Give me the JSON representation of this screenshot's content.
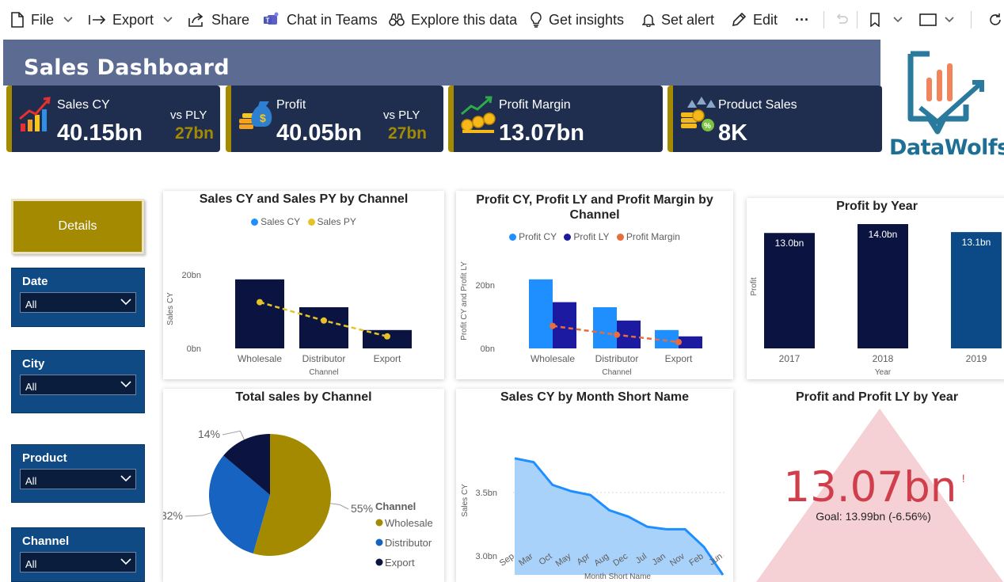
{
  "toolbar": {
    "file": "File",
    "export": "Export",
    "share": "Share",
    "chat_in_teams": "Chat in Teams",
    "explore": "Explore this data",
    "insights": "Get insights",
    "alert": "Set alert",
    "edit": "Edit",
    "more": "···"
  },
  "dashboard": {
    "title": "Sales Dashboard",
    "logo_text": "DataWolfs",
    "details_button": "Details"
  },
  "kpis": [
    {
      "label": "Sales CY",
      "value": "40.15bn",
      "vs": "vs PLY",
      "py": "27bn",
      "icon": "growth-chart-icon"
    },
    {
      "label": "Profit",
      "value": "40.05bn",
      "vs": "vs PLY",
      "py": "27bn",
      "icon": "money-bag-icon"
    },
    {
      "label": "Profit Margin",
      "value": "13.07bn",
      "icon": "coins-growth-icon"
    },
    {
      "label": "Product Sales",
      "value": "8K",
      "icon": "coins-percent-icon"
    }
  ],
  "slicers": [
    {
      "title": "Date",
      "value": "All"
    },
    {
      "title": "City",
      "value": "All"
    },
    {
      "title": "Product",
      "value": "All"
    },
    {
      "title": "Channel",
      "value": "All"
    }
  ],
  "colors": {
    "gold": "#a38a00",
    "navy": "#0b1441",
    "blue": "#1f8fff",
    "royal": "#1b1aa0",
    "orange": "#e86c3c",
    "yellow": "#e6c229",
    "area_fill": "#a9d2fb",
    "area_line": "#1f8fff",
    "pie_blue": "#1763c2",
    "kpi_red": "#d13e4b",
    "triangle": "#f5d0d5"
  },
  "charts": {
    "sales_by_channel": {
      "title": "Sales CY and Sales PY by Channel",
      "legend": [
        "Sales CY",
        "Sales PY"
      ],
      "ylabel": "Sales CY",
      "xlabel": "Channel",
      "ticks": [
        "20bn",
        "0bn"
      ]
    },
    "profit_by_channel": {
      "title_line1": "Profit CY, Profit LY and Profit Margin by",
      "title_line2": "Channel",
      "legend": [
        "Profit CY",
        "Profit LY",
        "Profit Margin"
      ],
      "ylabel": "Profit CY and Profit LY",
      "xlabel": "Channel",
      "ticks": [
        "20bn",
        "0bn"
      ]
    },
    "profit_by_year": {
      "title": "Profit by Year",
      "ylabel": "Profit",
      "xlabel": "Year"
    },
    "total_sales_pie": {
      "title": "Total sales by Channel",
      "legend_title": "Channel"
    },
    "sales_by_month": {
      "title": "Sales CY by Month Short Name",
      "ylabel": "Sales CY",
      "xlabel": "Month Short Name"
    },
    "profit_kpi": {
      "title": "Profit and Profit LY by Year",
      "value": "13.07bn",
      "alert": "!",
      "goal": "Goal: 13.99bn (-6.56%)"
    }
  },
  "chart_data": [
    {
      "type": "bar",
      "title": "Sales CY and Sales PY by Channel",
      "xlabel": "Channel",
      "ylabel": "Sales CY",
      "categories": [
        "Wholesale",
        "Distributor",
        "Export"
      ],
      "series": [
        {
          "name": "Sales CY",
          "type": "bar",
          "values": [
            21.8,
            13.0,
            5.8
          ]
        },
        {
          "name": "Sales PY",
          "type": "line",
          "values": [
            14.6,
            8.8,
            3.8
          ]
        }
      ],
      "ylim": [
        0,
        25
      ]
    },
    {
      "type": "bar",
      "title": "Profit CY, Profit LY and Profit Margin by Channel",
      "xlabel": "Channel",
      "ylabel": "Profit CY and Profit LY",
      "categories": [
        "Wholesale",
        "Distributor",
        "Export"
      ],
      "series": [
        {
          "name": "Profit CY",
          "type": "bar",
          "values": [
            21.8,
            13.0,
            5.8
          ]
        },
        {
          "name": "Profit LY",
          "type": "bar",
          "values": [
            14.6,
            8.8,
            3.8
          ]
        },
        {
          "name": "Profit Margin",
          "type": "line",
          "values": [
            7.1,
            4.3,
            2.0
          ]
        }
      ],
      "ylim": [
        0,
        25
      ]
    },
    {
      "type": "bar",
      "title": "Profit by Year",
      "xlabel": "Year",
      "ylabel": "Profit",
      "categories": [
        "2017",
        "2018",
        "2019"
      ],
      "values": [
        13.0,
        14.0,
        13.1
      ],
      "data_labels": [
        "13.0bn",
        "14.0bn",
        "13.1bn"
      ],
      "bar_colors": [
        "#0b1441",
        "#0b1441",
        "#0c4a87"
      ],
      "ylim": [
        0,
        14
      ]
    },
    {
      "type": "pie",
      "title": "Total sales by Channel",
      "legend_title": "Channel",
      "categories": [
        "Wholesale",
        "Distributor",
        "Export"
      ],
      "values": [
        55,
        32,
        14
      ],
      "labels": [
        "55%",
        "32%",
        "14%"
      ],
      "colors": [
        "#a38a00",
        "#1763c2",
        "#0b1441"
      ]
    },
    {
      "type": "area",
      "title": "Sales CY by Month Short Name",
      "xlabel": "Month Short Name",
      "ylabel": "Sales CY",
      "categories": [
        "Sep",
        "Mar",
        "Oct",
        "May",
        "Apr",
        "Aug",
        "Dec",
        "Jul",
        "Jan",
        "Nov",
        "Feb",
        "Jun"
      ],
      "values": [
        3.77,
        3.74,
        3.56,
        3.51,
        3.48,
        3.36,
        3.31,
        3.23,
        3.21,
        3.21,
        3.07,
        2.85
      ],
      "ticks": [
        "3.5bn",
        "3.0bn"
      ],
      "ylim": [
        2.85,
        3.78
      ]
    }
  ]
}
